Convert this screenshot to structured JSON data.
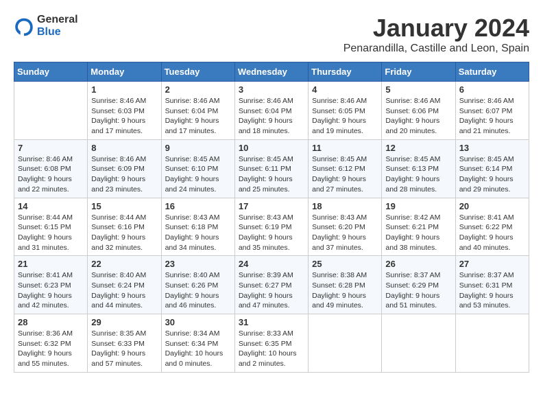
{
  "logo": {
    "text_general": "General",
    "text_blue": "Blue"
  },
  "title": {
    "month": "January 2024",
    "location": "Penarandilla, Castille and Leon, Spain"
  },
  "weekdays": [
    "Sunday",
    "Monday",
    "Tuesday",
    "Wednesday",
    "Thursday",
    "Friday",
    "Saturday"
  ],
  "weeks": [
    [
      {
        "day": "",
        "sunrise": "",
        "sunset": "",
        "daylight": ""
      },
      {
        "day": "1",
        "sunrise": "Sunrise: 8:46 AM",
        "sunset": "Sunset: 6:03 PM",
        "daylight": "Daylight: 9 hours and 17 minutes."
      },
      {
        "day": "2",
        "sunrise": "Sunrise: 8:46 AM",
        "sunset": "Sunset: 6:04 PM",
        "daylight": "Daylight: 9 hours and 17 minutes."
      },
      {
        "day": "3",
        "sunrise": "Sunrise: 8:46 AM",
        "sunset": "Sunset: 6:04 PM",
        "daylight": "Daylight: 9 hours and 18 minutes."
      },
      {
        "day": "4",
        "sunrise": "Sunrise: 8:46 AM",
        "sunset": "Sunset: 6:05 PM",
        "daylight": "Daylight: 9 hours and 19 minutes."
      },
      {
        "day": "5",
        "sunrise": "Sunrise: 8:46 AM",
        "sunset": "Sunset: 6:06 PM",
        "daylight": "Daylight: 9 hours and 20 minutes."
      },
      {
        "day": "6",
        "sunrise": "Sunrise: 8:46 AM",
        "sunset": "Sunset: 6:07 PM",
        "daylight": "Daylight: 9 hours and 21 minutes."
      }
    ],
    [
      {
        "day": "7",
        "sunrise": "Sunrise: 8:46 AM",
        "sunset": "Sunset: 6:08 PM",
        "daylight": "Daylight: 9 hours and 22 minutes."
      },
      {
        "day": "8",
        "sunrise": "Sunrise: 8:46 AM",
        "sunset": "Sunset: 6:09 PM",
        "daylight": "Daylight: 9 hours and 23 minutes."
      },
      {
        "day": "9",
        "sunrise": "Sunrise: 8:45 AM",
        "sunset": "Sunset: 6:10 PM",
        "daylight": "Daylight: 9 hours and 24 minutes."
      },
      {
        "day": "10",
        "sunrise": "Sunrise: 8:45 AM",
        "sunset": "Sunset: 6:11 PM",
        "daylight": "Daylight: 9 hours and 25 minutes."
      },
      {
        "day": "11",
        "sunrise": "Sunrise: 8:45 AM",
        "sunset": "Sunset: 6:12 PM",
        "daylight": "Daylight: 9 hours and 27 minutes."
      },
      {
        "day": "12",
        "sunrise": "Sunrise: 8:45 AM",
        "sunset": "Sunset: 6:13 PM",
        "daylight": "Daylight: 9 hours and 28 minutes."
      },
      {
        "day": "13",
        "sunrise": "Sunrise: 8:45 AM",
        "sunset": "Sunset: 6:14 PM",
        "daylight": "Daylight: 9 hours and 29 minutes."
      }
    ],
    [
      {
        "day": "14",
        "sunrise": "Sunrise: 8:44 AM",
        "sunset": "Sunset: 6:15 PM",
        "daylight": "Daylight: 9 hours and 31 minutes."
      },
      {
        "day": "15",
        "sunrise": "Sunrise: 8:44 AM",
        "sunset": "Sunset: 6:16 PM",
        "daylight": "Daylight: 9 hours and 32 minutes."
      },
      {
        "day": "16",
        "sunrise": "Sunrise: 8:43 AM",
        "sunset": "Sunset: 6:18 PM",
        "daylight": "Daylight: 9 hours and 34 minutes."
      },
      {
        "day": "17",
        "sunrise": "Sunrise: 8:43 AM",
        "sunset": "Sunset: 6:19 PM",
        "daylight": "Daylight: 9 hours and 35 minutes."
      },
      {
        "day": "18",
        "sunrise": "Sunrise: 8:43 AM",
        "sunset": "Sunset: 6:20 PM",
        "daylight": "Daylight: 9 hours and 37 minutes."
      },
      {
        "day": "19",
        "sunrise": "Sunrise: 8:42 AM",
        "sunset": "Sunset: 6:21 PM",
        "daylight": "Daylight: 9 hours and 38 minutes."
      },
      {
        "day": "20",
        "sunrise": "Sunrise: 8:41 AM",
        "sunset": "Sunset: 6:22 PM",
        "daylight": "Daylight: 9 hours and 40 minutes."
      }
    ],
    [
      {
        "day": "21",
        "sunrise": "Sunrise: 8:41 AM",
        "sunset": "Sunset: 6:23 PM",
        "daylight": "Daylight: 9 hours and 42 minutes."
      },
      {
        "day": "22",
        "sunrise": "Sunrise: 8:40 AM",
        "sunset": "Sunset: 6:24 PM",
        "daylight": "Daylight: 9 hours and 44 minutes."
      },
      {
        "day": "23",
        "sunrise": "Sunrise: 8:40 AM",
        "sunset": "Sunset: 6:26 PM",
        "daylight": "Daylight: 9 hours and 46 minutes."
      },
      {
        "day": "24",
        "sunrise": "Sunrise: 8:39 AM",
        "sunset": "Sunset: 6:27 PM",
        "daylight": "Daylight: 9 hours and 47 minutes."
      },
      {
        "day": "25",
        "sunrise": "Sunrise: 8:38 AM",
        "sunset": "Sunset: 6:28 PM",
        "daylight": "Daylight: 9 hours and 49 minutes."
      },
      {
        "day": "26",
        "sunrise": "Sunrise: 8:37 AM",
        "sunset": "Sunset: 6:29 PM",
        "daylight": "Daylight: 9 hours and 51 minutes."
      },
      {
        "day": "27",
        "sunrise": "Sunrise: 8:37 AM",
        "sunset": "Sunset: 6:31 PM",
        "daylight": "Daylight: 9 hours and 53 minutes."
      }
    ],
    [
      {
        "day": "28",
        "sunrise": "Sunrise: 8:36 AM",
        "sunset": "Sunset: 6:32 PM",
        "daylight": "Daylight: 9 hours and 55 minutes."
      },
      {
        "day": "29",
        "sunrise": "Sunrise: 8:35 AM",
        "sunset": "Sunset: 6:33 PM",
        "daylight": "Daylight: 9 hours and 57 minutes."
      },
      {
        "day": "30",
        "sunrise": "Sunrise: 8:34 AM",
        "sunset": "Sunset: 6:34 PM",
        "daylight": "Daylight: 10 hours and 0 minutes."
      },
      {
        "day": "31",
        "sunrise": "Sunrise: 8:33 AM",
        "sunset": "Sunset: 6:35 PM",
        "daylight": "Daylight: 10 hours and 2 minutes."
      },
      {
        "day": "",
        "sunrise": "",
        "sunset": "",
        "daylight": ""
      },
      {
        "day": "",
        "sunrise": "",
        "sunset": "",
        "daylight": ""
      },
      {
        "day": "",
        "sunrise": "",
        "sunset": "",
        "daylight": ""
      }
    ]
  ]
}
